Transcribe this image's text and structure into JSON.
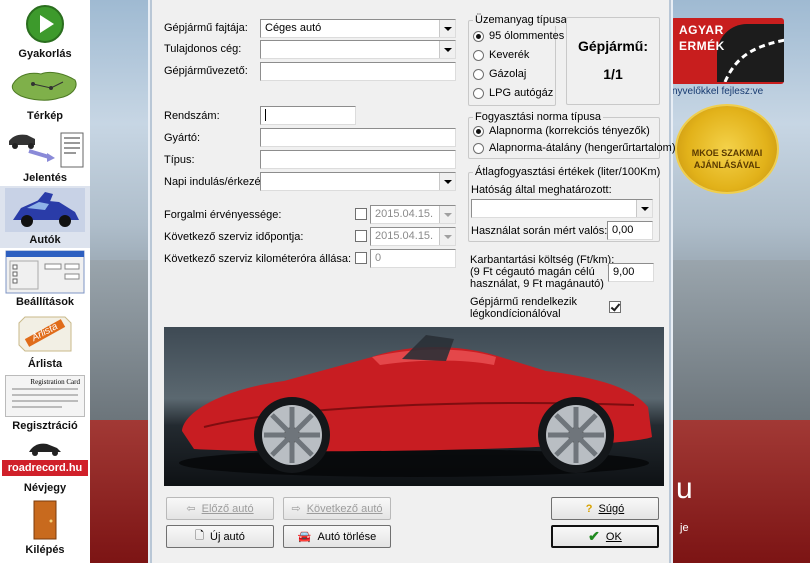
{
  "sidebar": {
    "items": [
      {
        "label": "Gyakorlás",
        "icon": "play-icon"
      },
      {
        "label": "Térkép",
        "icon": "map-icon"
      },
      {
        "label": "Jelentés",
        "icon": "report-icon"
      },
      {
        "label": "Autók",
        "icon": "car-icon"
      },
      {
        "label": "Beállítások",
        "icon": "settings-icon"
      },
      {
        "label": "Árlista",
        "icon": "pricelist-icon"
      },
      {
        "label": "Regisztráció",
        "icon": "registration-icon"
      },
      {
        "label": "Névjegy",
        "icon": "about-icon"
      },
      {
        "label": "Kilépés",
        "icon": "exit-door-icon"
      }
    ],
    "reg_card_text": "Registration Card",
    "arlista_text": "Árlista",
    "roadrecord_text": "roadrecord.hu"
  },
  "background": {
    "logo_line1": "AGYAR",
    "logo_line2": "ERMÉK",
    "tagline": "nyvelőkkel fejlesz:ve",
    "seal_line1": "MKOE SZAKMAI",
    "seal_line2": "AJÁNLÁSÁVAL",
    "big_text": "u",
    "bottom_text": "je"
  },
  "form": {
    "vehicle_type_label": "Gépjármű fajtája:",
    "vehicle_type_value": "Céges autó",
    "owner_company_label": "Tulajdonos cég:",
    "owner_company_value": "",
    "driver_label": "Gépjárművezető:",
    "driver_value": "",
    "plate_label": "Rendszám:",
    "plate_value": "",
    "manufacturer_label": "Gyártó:",
    "manufacturer_value": "",
    "model_label": "Típus:",
    "model_value": "",
    "daily_label": "Napi indulás/érkezés:",
    "daily_value": "",
    "validity_label": "Forgalmi érvényessége:",
    "validity_value": "2015.04.15.",
    "service_date_label": "Következő szerviz időpontja:",
    "service_date_value": "2015.04.15.",
    "service_km_label": "Következő szerviz kilométeróra állása:",
    "service_km_value": "0"
  },
  "fuel": {
    "title": "Üzemanyag típusa",
    "options": [
      "95 ólommentes",
      "Keverék",
      "Gázolaj",
      "LPG autógáz"
    ],
    "selected": 0
  },
  "counter": {
    "title": "Gépjármű:",
    "value": "1/1"
  },
  "norm": {
    "title": "Fogyasztási norma típusa",
    "options": [
      "Alapnorma (korrekciós tényezők)",
      "Alapnorma-átalány (hengerűrtartalom)"
    ],
    "selected": 0
  },
  "consumption": {
    "title": "Átlagfogyasztási értékek (liter/100Km)",
    "official_label": "Hatóság által meghatározott:",
    "official_value": "",
    "measured_label": "Használat során mért valós:",
    "measured_value": "0,00"
  },
  "maintenance": {
    "line1": "Karbantartási költség (Ft/km):",
    "line2": "(9 Ft cégautó magán célú",
    "line3": " használat, 9 Ft magánautó)",
    "value": "9,00"
  },
  "ac": {
    "line1": "Gépjármű rendelkezik",
    "line2": "légkondícionálóval",
    "checked": true
  },
  "buttons": {
    "prev": "Előző autó",
    "next": "Következő autó",
    "help": "Súgó",
    "new": "Új autó",
    "delete": "Autó törlése",
    "ok": "OK"
  },
  "colors": {
    "car": "#c81d22",
    "accent": "#c81e1e"
  }
}
